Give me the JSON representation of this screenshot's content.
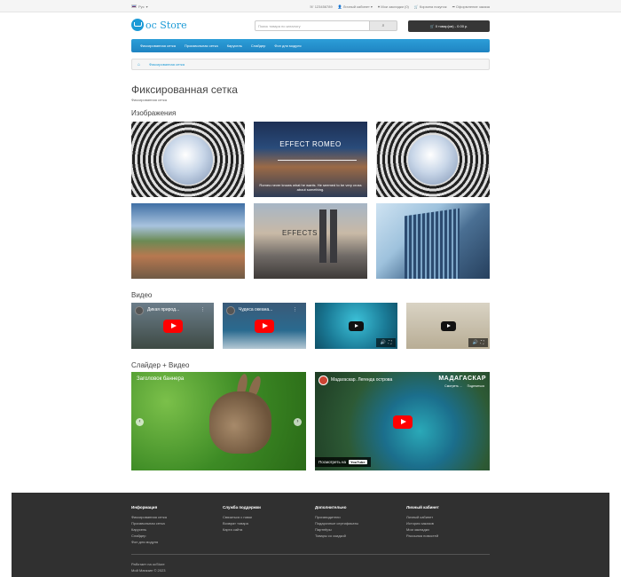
{
  "topbar": {
    "lang": "Рус",
    "phone": "123456789",
    "account": "Личный кабинет",
    "wishlist": "Мои закладки (0)",
    "cart": "Корзина покупок",
    "checkout": "Оформление заказа"
  },
  "header": {
    "logo_text": "oc Store",
    "search_placeholder": "Поиск товара по каталогу",
    "cart_button": "0 товар(ов) - 0.00 р."
  },
  "nav": {
    "items": [
      "Фиксированная сетка",
      "Произвольная сетка",
      "Карусель",
      "Слайдер",
      "Фон для модуля"
    ]
  },
  "breadcrumb": {
    "current": "Фиксированная сетка"
  },
  "page": {
    "title": "Фиксированная сетка",
    "subtitle": "Фиксированная сетка"
  },
  "sections": {
    "images": "Изображения",
    "video": "Видео",
    "slider_video": "Слайдер + Видео"
  },
  "images": {
    "romeo_title": "EFFECT ROMEO",
    "romeo_text": "Romeo never knows what he wants. He seemed to be very cross about something.",
    "effects_text": "EFFECTS"
  },
  "videos": [
    {
      "title": "Дикая природ..."
    },
    {
      "title": "Чудеса океана..."
    }
  ],
  "slider": {
    "caption": "Заголовок баннера"
  },
  "madagascar": {
    "title": "Мадагаскар. Легенда острова",
    "watermark": "МАДАГАСКАР",
    "watch_later": "Смотреть ...",
    "share": "Поделиться",
    "watch_on": "Посмотреть на",
    "yt_label": "YouTube"
  },
  "footer": {
    "columns": [
      {
        "title": "Информация",
        "links": [
          "Фиксированная сетка",
          "Произвольная сетка",
          "Карусель",
          "Слайдер",
          "Фон для модуля"
        ]
      },
      {
        "title": "Служба поддержки",
        "links": [
          "Связаться с нами",
          "Возврат товара",
          "Карта сайта"
        ]
      },
      {
        "title": "Дополнительно",
        "links": [
          "Производители",
          "Подарочные сертификаты",
          "Партнёры",
          "Товары со скидкой"
        ]
      },
      {
        "title": "Личный кабинет",
        "links": [
          "Личный кабинет",
          "История заказов",
          "Мои закладки",
          "Рассылка новостей"
        ]
      }
    ],
    "powered": "Работает на ocStore",
    "copyright": "Мой Магазин © 2023"
  }
}
